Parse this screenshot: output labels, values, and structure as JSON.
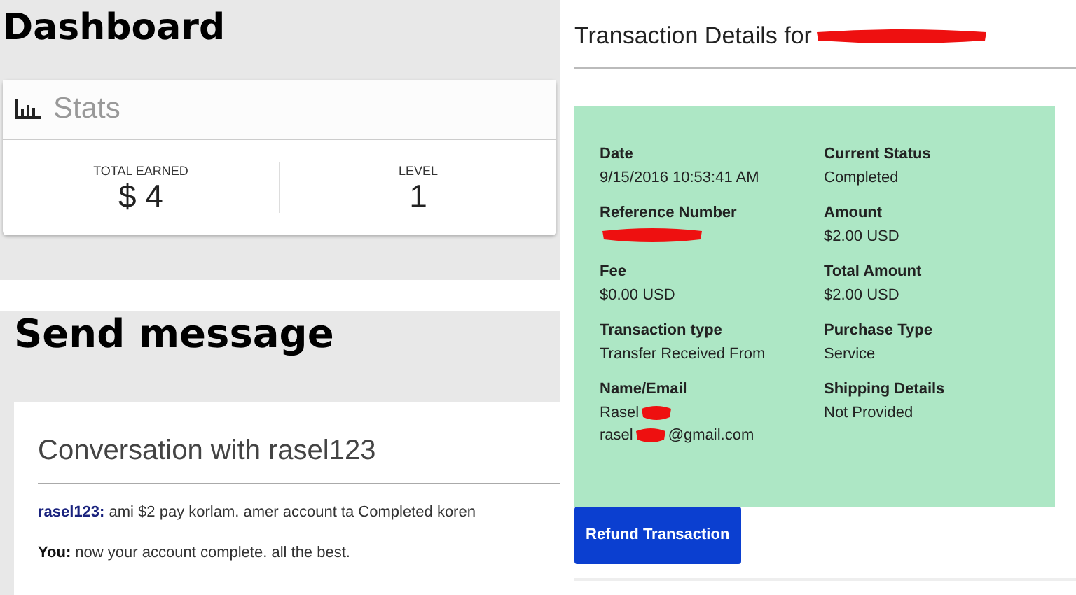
{
  "dashboard": {
    "title": "Dashboard",
    "stats": {
      "title": "Stats",
      "items": [
        {
          "label": "TOTAL EARNED",
          "value": "$ 4"
        },
        {
          "label": "LEVEL",
          "value": "1"
        }
      ]
    }
  },
  "send_message": {
    "title": "Send message",
    "conversation_title": "Conversation with rasel123",
    "messages": [
      {
        "sender": "rasel123:",
        "kind": "other",
        "text": "ami $2 pay korlam. amer account ta Completed koren"
      },
      {
        "sender": "You:",
        "kind": "self",
        "text": "now your account complete. all the best."
      }
    ]
  },
  "transaction": {
    "title": "Transaction Details for",
    "title_redacted": true,
    "fields": [
      {
        "label": "Date",
        "lines": [
          {
            "text": "9/15/2016 10:53:41 AM",
            "redacted": false
          }
        ]
      },
      {
        "label": "Current Status",
        "lines": [
          {
            "text": "Completed",
            "redacted": false
          }
        ]
      },
      {
        "label": "Reference Number",
        "lines": [
          {
            "redacted": true
          }
        ]
      },
      {
        "label": "Amount",
        "lines": [
          {
            "text": "$2.00 USD",
            "redacted": false
          }
        ]
      },
      {
        "label": "Fee",
        "lines": [
          {
            "text": "$0.00 USD",
            "redacted": false
          }
        ]
      },
      {
        "label": "Total Amount",
        "lines": [
          {
            "text": "$2.00 USD",
            "redacted": false
          }
        ]
      },
      {
        "label": "Transaction type",
        "lines": [
          {
            "text": "Transfer Received From",
            "redacted": false
          }
        ]
      },
      {
        "label": "Purchase Type",
        "lines": [
          {
            "text": "Service",
            "redacted": false
          }
        ]
      },
      {
        "label": "Name/Email",
        "lines": [
          {
            "text": "Rasel",
            "redacted": true
          },
          {
            "text": "rasel",
            "redacted": true,
            "suffix": "@gmail.com"
          }
        ]
      },
      {
        "label": "Shipping Details",
        "lines": [
          {
            "text": "Not Provided",
            "redacted": false
          }
        ]
      }
    ],
    "button": "Refund Transaction"
  }
}
